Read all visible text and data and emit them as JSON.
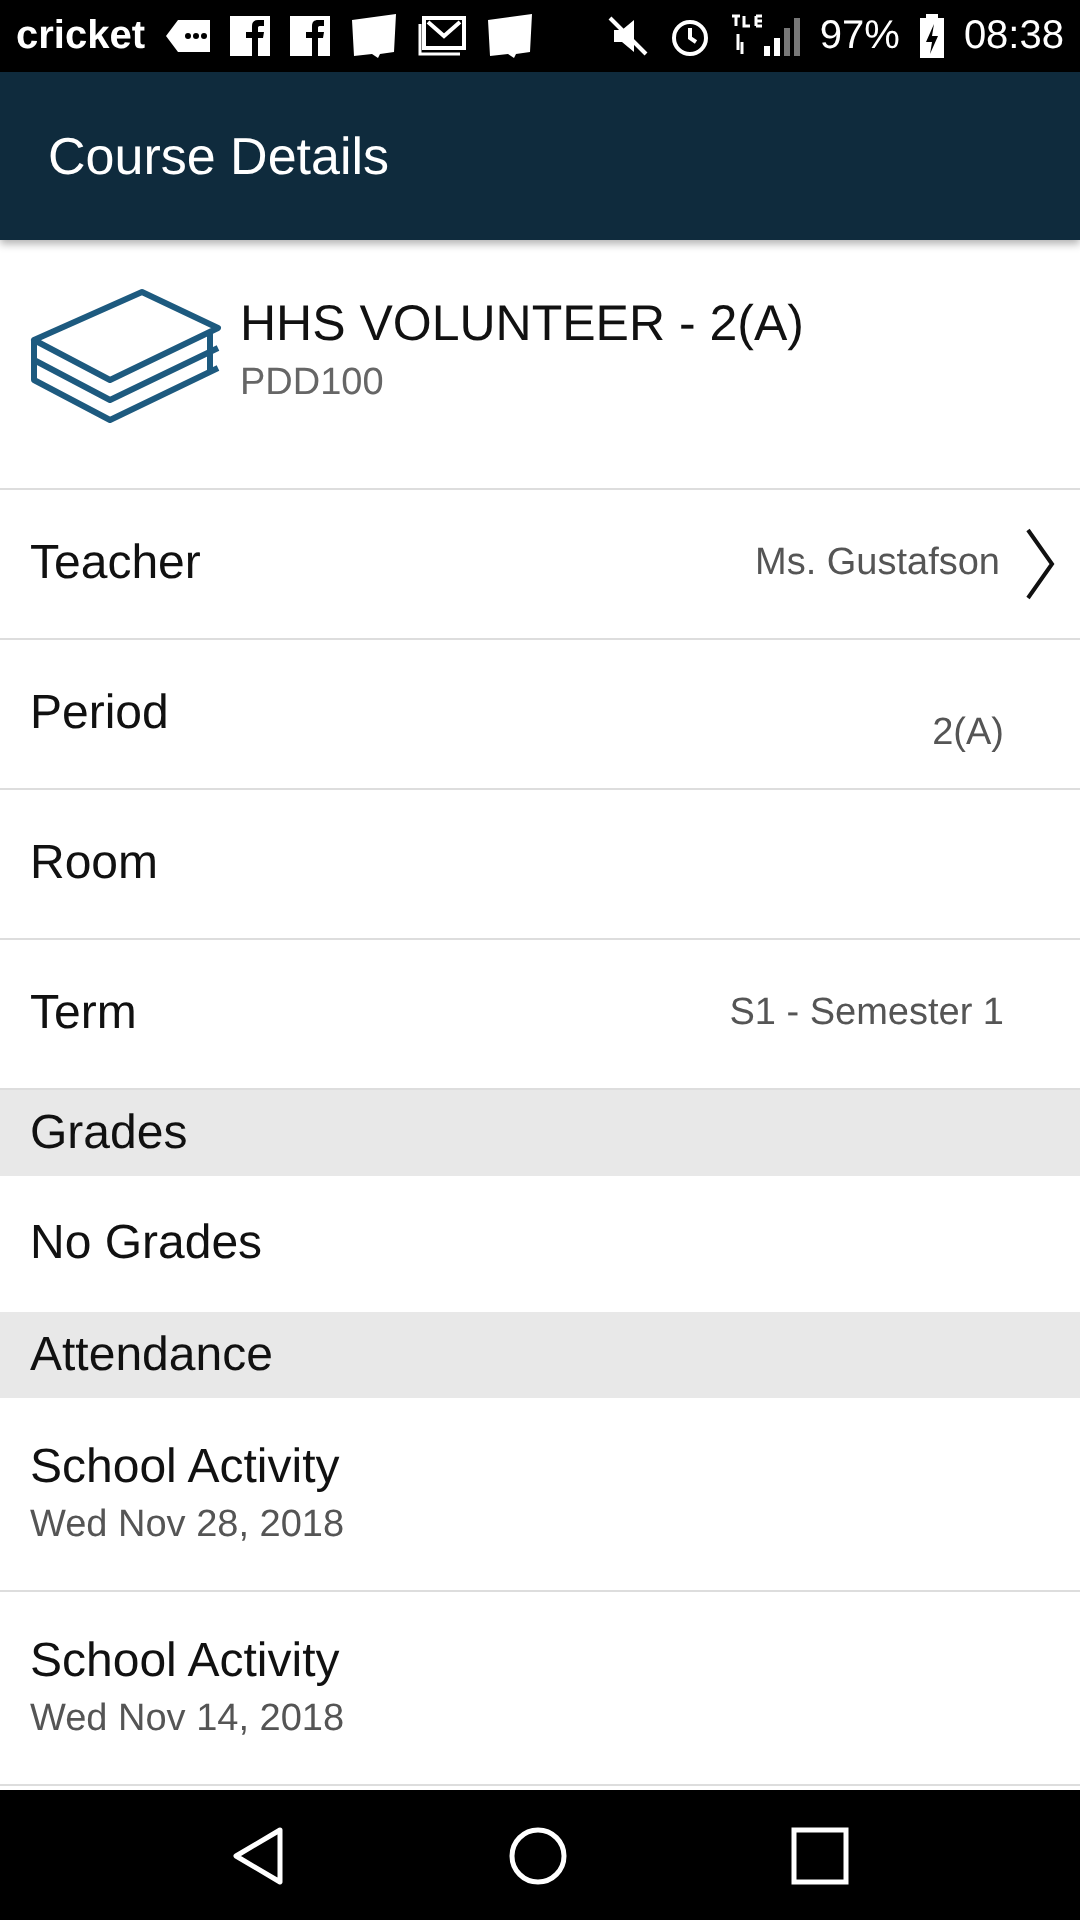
{
  "status_bar": {
    "carrier": "cricket",
    "battery": "97%",
    "time": "08:38"
  },
  "app_bar": {
    "title": "Course Details"
  },
  "course": {
    "name": "HHS VOLUNTEER - 2(A)",
    "code": "PDD100"
  },
  "details": [
    {
      "label": "Teacher",
      "value": "Ms. Gustafson",
      "link": true
    },
    {
      "label": "Period",
      "value": "2(A)",
      "link": false
    },
    {
      "label": "Room",
      "link": false
    },
    {
      "label": "Term",
      "value": "S1 - Semester 1",
      "link": false
    }
  ],
  "grades": {
    "title": "Grades",
    "items": [
      {
        "text": "No Grades"
      }
    ]
  },
  "attendance": {
    "title": "Attendance",
    "items": [
      {
        "title": "School Activity",
        "date": "Wed Nov 28, 2018"
      },
      {
        "title": "School Activity",
        "date": "Wed Nov 14, 2018"
      }
    ]
  }
}
